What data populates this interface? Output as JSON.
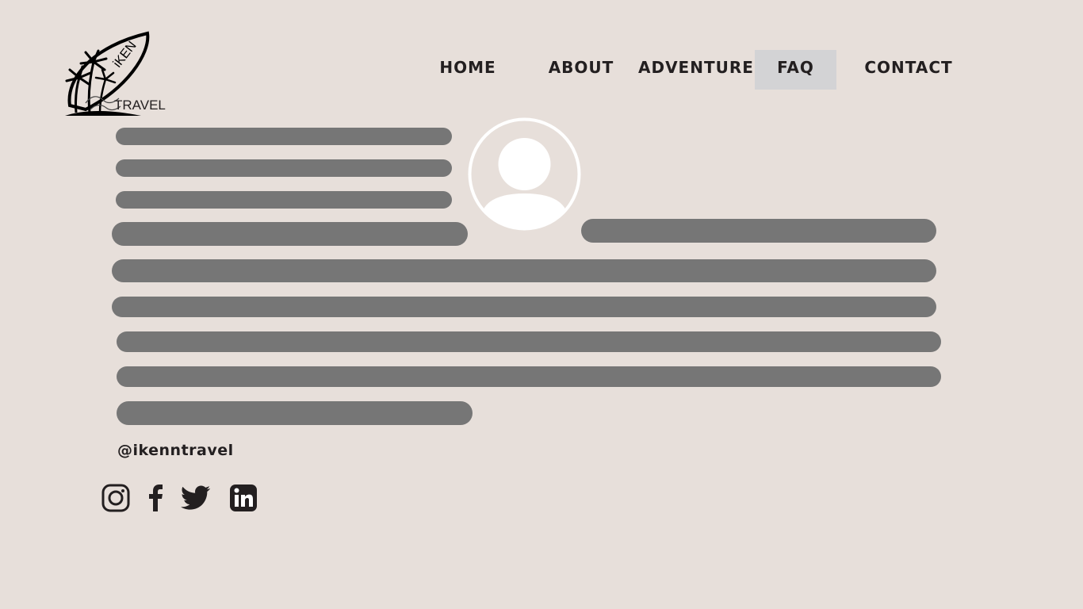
{
  "brand": {
    "logo_icon": "surfboard-palm-logo",
    "logo_top": "iKEN",
    "logo_bottom": "TRAVEL"
  },
  "nav": {
    "items": [
      {
        "label": "HOME"
      },
      {
        "label": "ABOUT"
      },
      {
        "label": "ADVENTURE"
      },
      {
        "label": "FAQ",
        "active": true
      },
      {
        "label": "CONTACT"
      }
    ]
  },
  "profile": {
    "avatar_icon": "user-avatar-icon"
  },
  "footer": {
    "handle": "@ikenntravel",
    "social_icons": [
      "instagram-icon",
      "facebook-icon",
      "twitter-icon",
      "linkedin-icon"
    ]
  },
  "colors": {
    "background": "#e7dfda",
    "placeholder_bar": "#767676",
    "active_nav_bg": "#d3d3d5",
    "text": "#231f20"
  }
}
